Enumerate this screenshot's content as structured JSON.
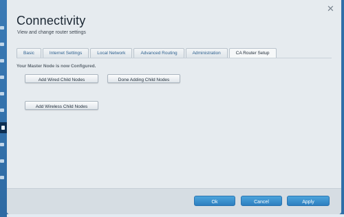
{
  "dialog": {
    "title": "Connectivity",
    "subtitle": "View and change router settings",
    "close_icon": "close-icon"
  },
  "tabs": [
    {
      "label": "Basic",
      "active": false
    },
    {
      "label": "Internet Settings",
      "active": false
    },
    {
      "label": "Local Network",
      "active": false
    },
    {
      "label": "Advanced Routing",
      "active": false
    },
    {
      "label": "Administration",
      "active": false
    },
    {
      "label": "CA Router Setup",
      "active": true
    }
  ],
  "panel": {
    "status": "Your Master Node is now Configured.",
    "add_wired_label": "Add Wired Child Nodes",
    "done_adding_label": "Done Adding Child Nodes",
    "add_wireless_label": "Add Wireless Child Nodes"
  },
  "footer": {
    "ok_label": "Ok",
    "cancel_label": "Cancel",
    "apply_label": "Apply"
  },
  "colors": {
    "accent": "#2d7fc0",
    "background": "#2f6fa8",
    "dialog": "#e6ebef"
  }
}
